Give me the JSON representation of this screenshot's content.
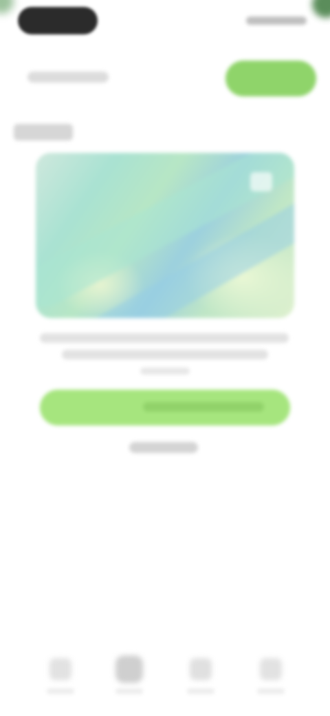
{
  "status_bar": {},
  "header": {},
  "section": {},
  "hero": {},
  "description": {},
  "cta": {},
  "secondary": {},
  "bottom_nav": {
    "items": [
      {
        "icon": "tab-icon"
      },
      {
        "icon": "tab-icon"
      },
      {
        "icon": "tab-icon"
      },
      {
        "icon": "tab-icon"
      }
    ]
  },
  "colors": {
    "accent": "#8fd46a",
    "cta": "#a6e57e",
    "background": "#ffffff",
    "status_pill": "#2b2b2b"
  }
}
